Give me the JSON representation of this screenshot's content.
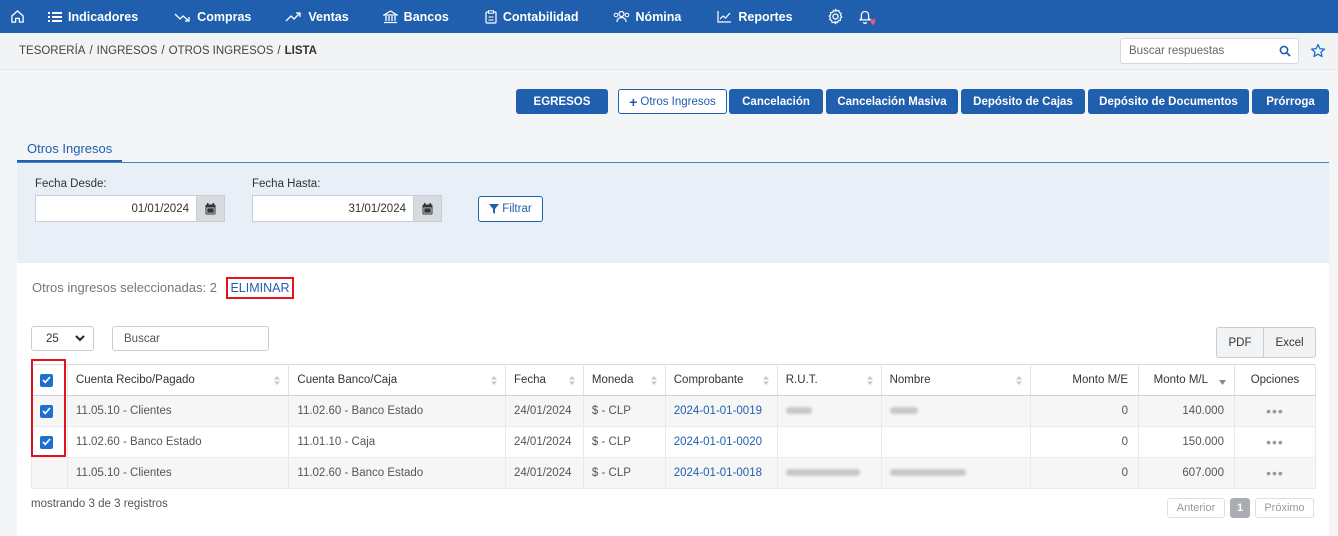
{
  "nav": {
    "items": [
      "Indicadores",
      "Compras",
      "Ventas",
      "Bancos",
      "Contabilidad",
      "Nómina",
      "Reportes"
    ]
  },
  "breadcrumb": {
    "p1": "TESORERÍA",
    "p2": "INGRESOS",
    "p3": "OTROS INGRESOS",
    "p4": "LISTA",
    "sep": "/"
  },
  "search": {
    "placeholder": "Buscar respuestas"
  },
  "actions": {
    "egresos": "EGRESOS",
    "otros": "Otros Ingresos",
    "cancelacion": "Cancelación",
    "masiva": "Cancelación Masiva",
    "cajas": "Depósito de Cajas",
    "documentos": "Depósito de Documentos",
    "prorroga": "Prórroga"
  },
  "tab": {
    "label": "Otros Ingresos"
  },
  "filter": {
    "desde_label": "Fecha Desde:",
    "desde_value": "01/01/2024",
    "hasta_label": "Fecha Hasta:",
    "hasta_value": "31/01/2024",
    "button": "Filtrar"
  },
  "selection": {
    "text": "Otros ingresos seleccionadas: 2",
    "delete": "ELIMINAR"
  },
  "table": {
    "page_size": "25",
    "search_placeholder": "Buscar",
    "export_pdf": "PDF",
    "export_excel": "Excel",
    "headers": {
      "cuenta": "Cuenta Recibo/Pagado",
      "banco": "Cuenta Banco/Caja",
      "fecha": "Fecha",
      "moneda": "Moneda",
      "comprobante": "Comprobante",
      "rut": "R.U.T.",
      "nombre": "Nombre",
      "monto_me": "Monto M/E",
      "monto_ml": "Monto M/L",
      "opciones": "Opciones"
    },
    "rows": [
      {
        "cuenta": "11.05.10 - Clientes",
        "banco": "11.02.60 - Banco Estado",
        "fecha": "24/01/2024",
        "moneda": "$ - CLP",
        "comprobante": "2024-01-01-0019",
        "monto_me": "0",
        "monto_ml": "140.000",
        "opciones": "•••"
      },
      {
        "cuenta": "11.02.60 - Banco Estado",
        "banco": "11.01.10 - Caja",
        "fecha": "24/01/2024",
        "moneda": "$ - CLP",
        "comprobante": "2024-01-01-0020",
        "monto_me": "0",
        "monto_ml": "150.000",
        "opciones": "•••"
      },
      {
        "cuenta": "11.05.10 - Clientes",
        "banco": "11.02.60 - Banco Estado",
        "fecha": "24/01/2024",
        "moneda": "$ - CLP",
        "comprobante": "2024-01-01-0018",
        "monto_me": "0",
        "monto_ml": "607.000",
        "opciones": "•••"
      }
    ],
    "showing": "mostrando 3 de 3 registros",
    "prev": "Anterior",
    "page": "1",
    "next": "Próximo"
  },
  "colors": {
    "brand": "#1f5fae",
    "highlight": "#e0141e"
  }
}
